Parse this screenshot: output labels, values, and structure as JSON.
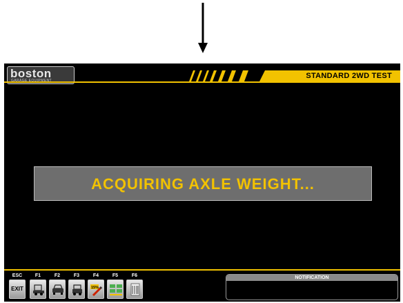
{
  "header": {
    "logo_text": "boston",
    "logo_subtext": "GARAGE EQUIPMENT",
    "title": "STANDARD 2WD TEST"
  },
  "status": {
    "message": "ACQUIRING AXLE WEIGHT..."
  },
  "footer": {
    "keys": [
      {
        "key": "ESC",
        "label": "EXIT",
        "icon": "exit-icon"
      },
      {
        "key": "F1",
        "icon": "vehicle-side-icon"
      },
      {
        "key": "F2",
        "icon": "vehicle-front-icon"
      },
      {
        "key": "F3",
        "icon": "vehicle-rear-icon"
      },
      {
        "key": "F4",
        "icon": "percent-edit-icon",
        "badge": "15%"
      },
      {
        "key": "F5",
        "icon": "layout-grid-icon"
      },
      {
        "key": "F6",
        "icon": "document-icon"
      }
    ],
    "notification_label": "NOTIFICATION",
    "notification_text": ""
  },
  "colors": {
    "accent": "#f2c200",
    "background": "#000000",
    "panel": "#6e6e6e"
  }
}
